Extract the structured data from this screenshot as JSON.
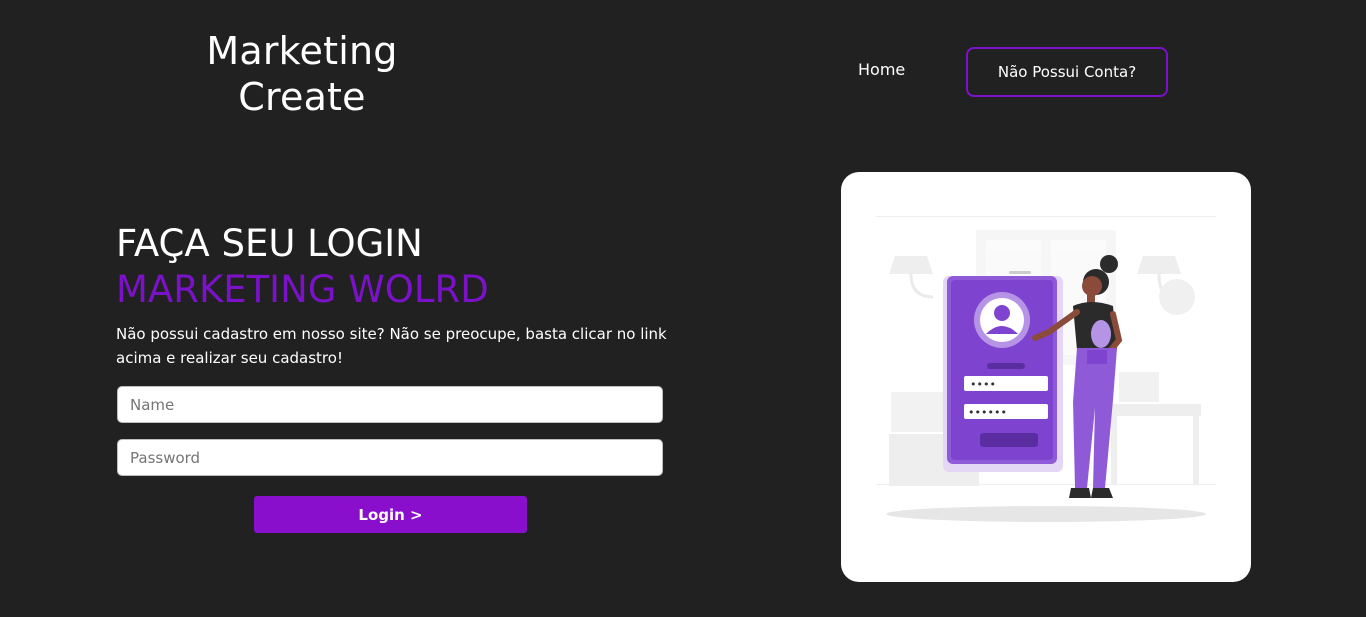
{
  "header": {
    "brand_line1": "Marketing",
    "brand_line2": "Create",
    "nav_home": "Home",
    "nav_signup": "Não Possui Conta?"
  },
  "main": {
    "heading_line1": "FAÇA SEU LOGIN",
    "heading_line2": "MARKETING WOLRD",
    "subtitle": "Não possui cadastro em nosso site? Não se preocupe, basta clicar no link acima e realizar seu cadastro!",
    "name_placeholder": "Name",
    "password_placeholder": "Password",
    "login_label": "Login >"
  },
  "colors": {
    "background": "#212121",
    "accent": "#7b12c9",
    "button": "#8a0fcc",
    "card": "#ffffff"
  },
  "illustration": {
    "icon": "login-illustration-icon",
    "password_dots_1": "••••",
    "password_dots_2": "••••••"
  }
}
